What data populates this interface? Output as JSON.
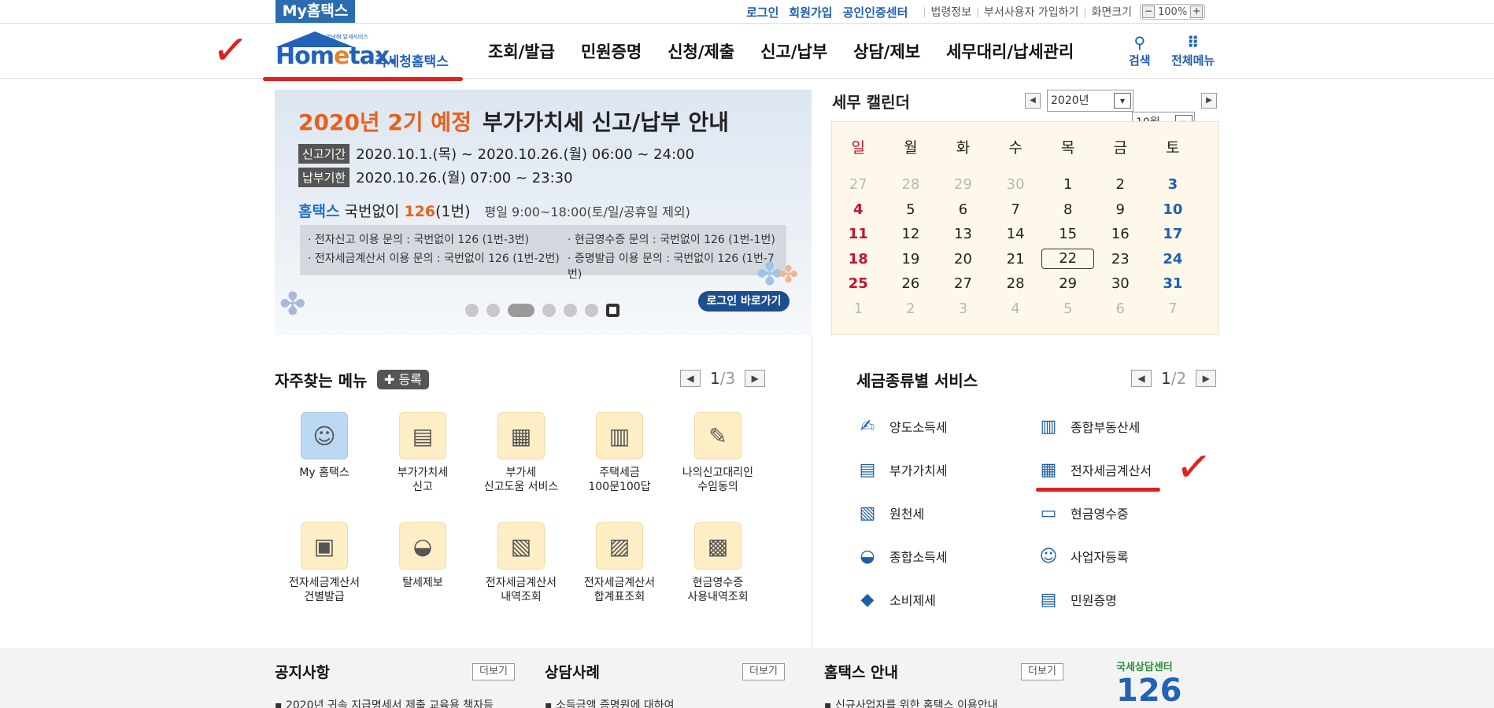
{
  "topbar": {
    "my_hometax": "My홈택스",
    "login": "로그인",
    "signup": "회원가입",
    "cert": "공인인증센터",
    "laws": "법령정보",
    "dept_signup": "부서사용자 가입하기",
    "screen_size": "화면크기",
    "zoom_minus": "−",
    "zoom_value": "100%",
    "zoom_plus": "+"
  },
  "header": {
    "logo_small": "안녕해 알세서비스",
    "logo_text_a": "Hom",
    "logo_text_e": "e",
    "logo_text_b": "tax.",
    "logo_kor": "국세청홈택스",
    "nav": [
      "조회/발급",
      "민원증명",
      "신청/제출",
      "신고/납부",
      "상담/제보",
      "세무대리/납세관리"
    ],
    "search": "검색",
    "all_menu": "전체메뉴"
  },
  "banner": {
    "title_orange": "2020년 2기 예정",
    "title_rest": "부가가치세 신고/납부 안내",
    "period_tag": "신고기간",
    "period_text": "2020.10.1.(목) ~ 2020.10.26.(월) 06:00 ~ 24:00",
    "due_tag": "납부기한",
    "due_text": "2020.10.26.(월) 07:00 ~ 23:30",
    "phone_blue": "홈택스",
    "phone_mid": " 국번없이 ",
    "phone_num": "126",
    "phone_ext": "(1번)",
    "phone_hours": "평일 9:00~18:00(토/일/공휴일 제외)",
    "info_1": "· 전자신고 이용 문의 : 국번없이 126 (1번-3번)",
    "info_2": "· 현금영수증 문의 : 국번없이 126 (1번-1번)",
    "info_3": "· 전자세금계산서 이용 문의 : 국번없이 126 (1번-2번)",
    "info_4": "· 증명발급 이용 문의 : 국번없이 126 (1번-7번)",
    "login_go": "로그인 바로가기"
  },
  "calendar": {
    "title": "세무 캘린더",
    "year": "2020년",
    "month": "10월",
    "weekdays": [
      "일",
      "월",
      "화",
      "수",
      "목",
      "금",
      "토"
    ],
    "weeks": [
      [
        "27",
        "28",
        "29",
        "30",
        "1",
        "2",
        "3"
      ],
      [
        "4",
        "5",
        "6",
        "7",
        "8",
        "9",
        "10"
      ],
      [
        "11",
        "12",
        "13",
        "14",
        "15",
        "16",
        "17"
      ],
      [
        "18",
        "19",
        "20",
        "21",
        "22",
        "23",
        "24"
      ],
      [
        "25",
        "26",
        "27",
        "28",
        "29",
        "30",
        "31"
      ],
      [
        "1",
        "2",
        "3",
        "4",
        "5",
        "6",
        "7"
      ]
    ],
    "today": "22"
  },
  "favorites": {
    "title": "자주찾는 메뉴",
    "register": "✚ 등록",
    "page": "1",
    "total": "/3",
    "items": [
      {
        "l1": "My 홈택스",
        "l2": "",
        "icon": "person-icon"
      },
      {
        "l1": "부가가치세",
        "l2": "신고",
        "icon": "vat-icon"
      },
      {
        "l1": "부가세",
        "l2": "신고도움 서비스",
        "icon": "vat-help-icon"
      },
      {
        "l1": "주택세금",
        "l2": "100문100답",
        "icon": "building-icon"
      },
      {
        "l1": "나의신고대리인",
        "l2": "수임동의",
        "icon": "consent-icon"
      },
      {
        "l1": "전자세금계산서",
        "l2": "건별발급",
        "icon": "calculator-icon"
      },
      {
        "l1": "탈세제보",
        "l2": "",
        "icon": "tax-bag-icon"
      },
      {
        "l1": "전자세금계산서",
        "l2": "내역조회",
        "icon": "invoice-search-icon"
      },
      {
        "l1": "전자세금계산서",
        "l2": "합계표조회",
        "icon": "invoice-sum-icon"
      },
      {
        "l1": "현금영수증",
        "l2": "사용내역조회",
        "icon": "receipt-search-icon"
      }
    ]
  },
  "services": {
    "title": "세금종류별 서비스",
    "page": "1",
    "total": "/2",
    "items": [
      {
        "label": "양도소득세",
        "icon": "transfer-tax-icon"
      },
      {
        "label": "종합부동산세",
        "icon": "real-estate-icon"
      },
      {
        "label": "부가가치세",
        "icon": "vat-icon"
      },
      {
        "label": "전자세금계산서",
        "icon": "e-invoice-icon"
      },
      {
        "label": "원천세",
        "icon": "withholding-icon"
      },
      {
        "label": "현금영수증",
        "icon": "cash-receipt-icon"
      },
      {
        "label": "종합소득세",
        "icon": "income-tax-icon"
      },
      {
        "label": "사업자등록",
        "icon": "business-reg-icon"
      },
      {
        "label": "소비제세",
        "icon": "diamond-icon"
      },
      {
        "label": "민원증명",
        "icon": "certificate-icon"
      }
    ]
  },
  "bottom": {
    "notice_title": "공지사항",
    "notice_more": "더보기",
    "notice_item": "2020년 귀속 지급명세서 제출 교육용 책자등",
    "consult_title": "상담사례",
    "consult_more": "더보기",
    "consult_item": "소득금액 증명원에 대하여",
    "guide_title": "홈택스 안내",
    "guide_more": "더보기",
    "guide_item": "신규사업자를 위한 홈택스 이용안내",
    "center_text": "국세상담센터",
    "center_num": "126"
  }
}
